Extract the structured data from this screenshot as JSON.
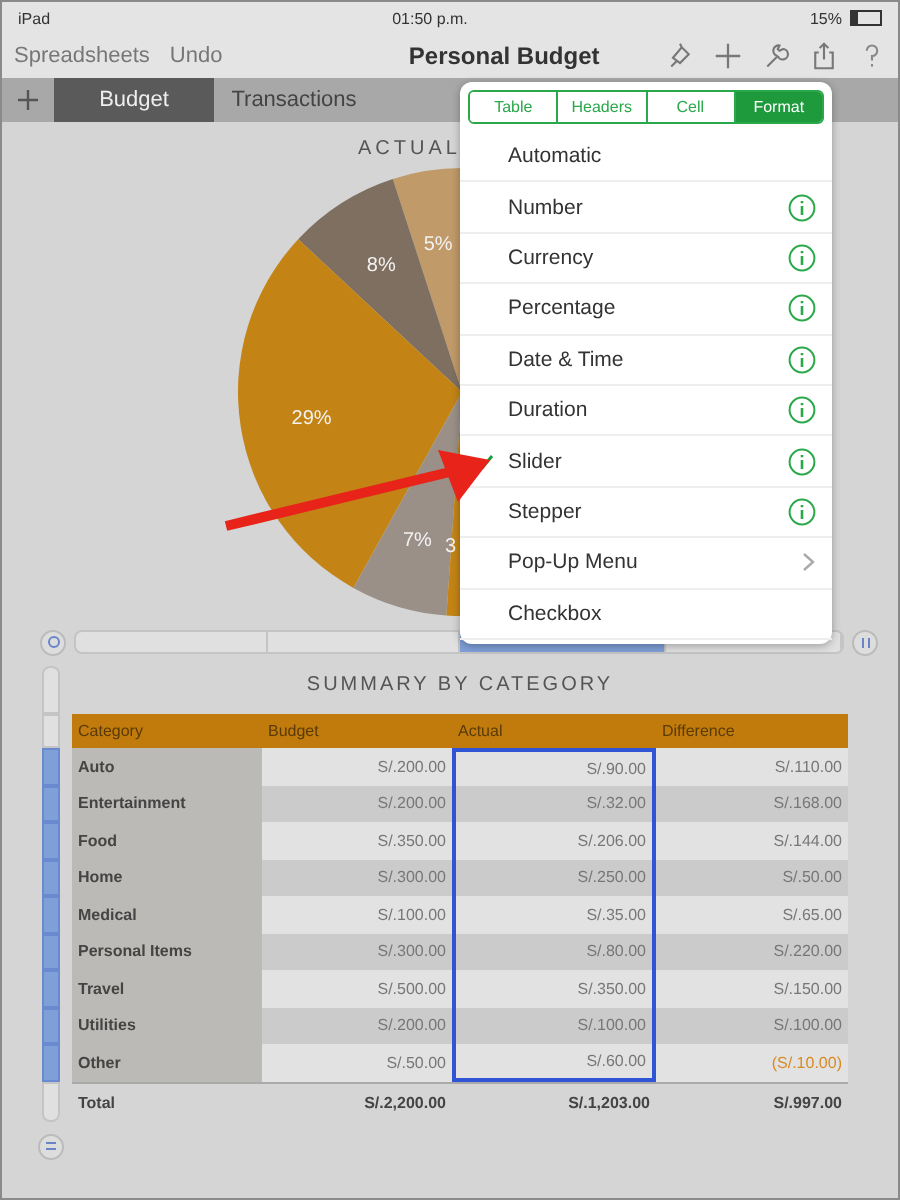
{
  "status_bar": {
    "device": "iPad",
    "time": "01:50 p.m.",
    "battery": "15%"
  },
  "toolbar": {
    "left": [
      "Spreadsheets",
      "Undo"
    ],
    "title": "Personal Budget"
  },
  "sheet_tabs": [
    {
      "label": "Budget",
      "selected": true
    },
    {
      "label": "Transactions",
      "selected": false
    }
  ],
  "chart": {
    "title": "ACTUAL",
    "slice_labels": [
      "5%",
      "8%",
      "29%",
      "7%",
      "3"
    ]
  },
  "popover": {
    "segments": [
      {
        "label": "Table",
        "selected": false
      },
      {
        "label": "Headers",
        "selected": false
      },
      {
        "label": "Cell",
        "selected": false
      },
      {
        "label": "Format",
        "selected": true
      }
    ],
    "items": [
      {
        "label": "Automatic",
        "kind": "plain",
        "checked": false
      },
      {
        "label": "Number",
        "kind": "info",
        "checked": false
      },
      {
        "label": "Currency",
        "kind": "info",
        "checked": false
      },
      {
        "label": "Percentage",
        "kind": "info",
        "checked": false
      },
      {
        "label": "Date & Time",
        "kind": "info",
        "checked": false
      },
      {
        "label": "Duration",
        "kind": "info",
        "checked": false
      },
      {
        "label": "Slider",
        "kind": "info",
        "checked": true
      },
      {
        "label": "Stepper",
        "kind": "info",
        "checked": false
      },
      {
        "label": "Pop-Up Menu",
        "kind": "submenu",
        "checked": false
      },
      {
        "label": "Checkbox",
        "kind": "plain",
        "checked": false
      }
    ]
  },
  "table": {
    "title": "SUMMARY BY CATEGORY",
    "columns": [
      {
        "label": "Category",
        "selected": false
      },
      {
        "label": "Budget",
        "selected": false
      },
      {
        "label": "Actual",
        "selected": true
      },
      {
        "label": "Difference",
        "selected": false
      }
    ],
    "rows": [
      {
        "cells": [
          "Auto",
          "S/.200.00",
          "S/.90.00",
          "S/.110.00"
        ],
        "negative": false,
        "selected": true
      },
      {
        "cells": [
          "Entertainment",
          "S/.200.00",
          "S/.32.00",
          "S/.168.00"
        ],
        "negative": false,
        "selected": true
      },
      {
        "cells": [
          "Food",
          "S/.350.00",
          "S/.206.00",
          "S/.144.00"
        ],
        "negative": false,
        "selected": true
      },
      {
        "cells": [
          "Home",
          "S/.300.00",
          "S/.250.00",
          "S/.50.00"
        ],
        "negative": false,
        "selected": true
      },
      {
        "cells": [
          "Medical",
          "S/.100.00",
          "S/.35.00",
          "S/.65.00"
        ],
        "negative": false,
        "selected": true
      },
      {
        "cells": [
          "Personal Items",
          "S/.300.00",
          "S/.80.00",
          "S/.220.00"
        ],
        "negative": false,
        "selected": true
      },
      {
        "cells": [
          "Travel",
          "S/.500.00",
          "S/.350.00",
          "S/.150.00"
        ],
        "negative": false,
        "selected": true
      },
      {
        "cells": [
          "Utilities",
          "S/.200.00",
          "S/.100.00",
          "S/.100.00"
        ],
        "negative": false,
        "selected": true
      },
      {
        "cells": [
          "Other",
          "S/.50.00",
          "S/.60.00",
          "(S/.10.00)"
        ],
        "negative": true,
        "selected": true
      }
    ],
    "total": [
      "Total",
      "S/.2,200.00",
      "S/.1,203.00",
      "S/.997.00"
    ]
  }
}
